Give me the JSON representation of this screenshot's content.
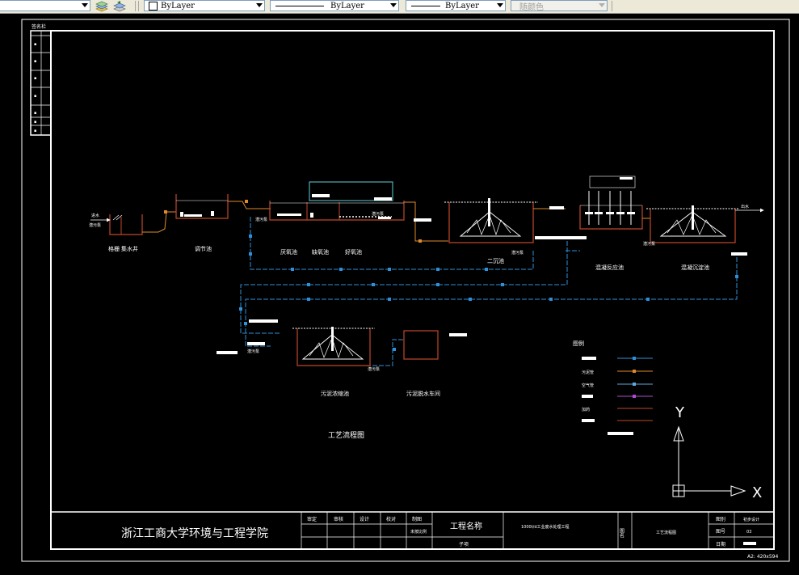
{
  "toolbar": {
    "layer_icon_1": "layer-states-icon",
    "layer_icon_2": "layer-previous-icon",
    "color_combo": "ByLayer",
    "linetype_combo": "ByLayer",
    "lineweight_combo": "ByLayer",
    "plotstyle_combo": "随颜色"
  },
  "drawing": {
    "margin_label": "签名栏",
    "units": {
      "screen": "格栅",
      "sump": "集水井",
      "equalization": "调节池",
      "anoxic": "厌氧池",
      "anaerobic": "缺氧池",
      "aerobic": "好氧池",
      "secondary_clarifier": "二沉池",
      "coagulation": "混凝反应池",
      "sedimentation": "混凝沉淀池",
      "sludge_thickener": "污泥浓缩池",
      "sludge_dewatering": "污泥脱水车间"
    },
    "small_labels": {
      "raw_water": "进水",
      "effluent": "出水",
      "pump_a": "潜污泵",
      "pump_b": "潜污泵",
      "pump_c": "潜污泵",
      "pump_d": "潜污泵",
      "pump_e": "潜污泵",
      "pump_f": "潜污泵",
      "pump_g": "潜污泵"
    },
    "flow_title": "工艺流程图",
    "legend": {
      "title": "图例",
      "row2": "污泥管",
      "row3": "空气管",
      "row5": "加药"
    },
    "axes": {
      "y": "Y",
      "x": "X"
    }
  },
  "title_block": {
    "institution": "浙江工商大学环境与工程学院",
    "header_cells": [
      "审定",
      "审核",
      "设计",
      "校对",
      "制图"
    ],
    "scale_value": "未按比例",
    "project_name_label": "工程名称",
    "project_sub_label": "子项",
    "project_name_value": "1000t/d工业废水处理工程",
    "drawing_label": "图名",
    "drawing_name_value": "工艺流程图",
    "stage_label": "图别",
    "stage_value": "初步设计",
    "number_label": "图号",
    "number_value": "03",
    "date_label": "日期",
    "sheet_size": "A2:  420x594"
  }
}
